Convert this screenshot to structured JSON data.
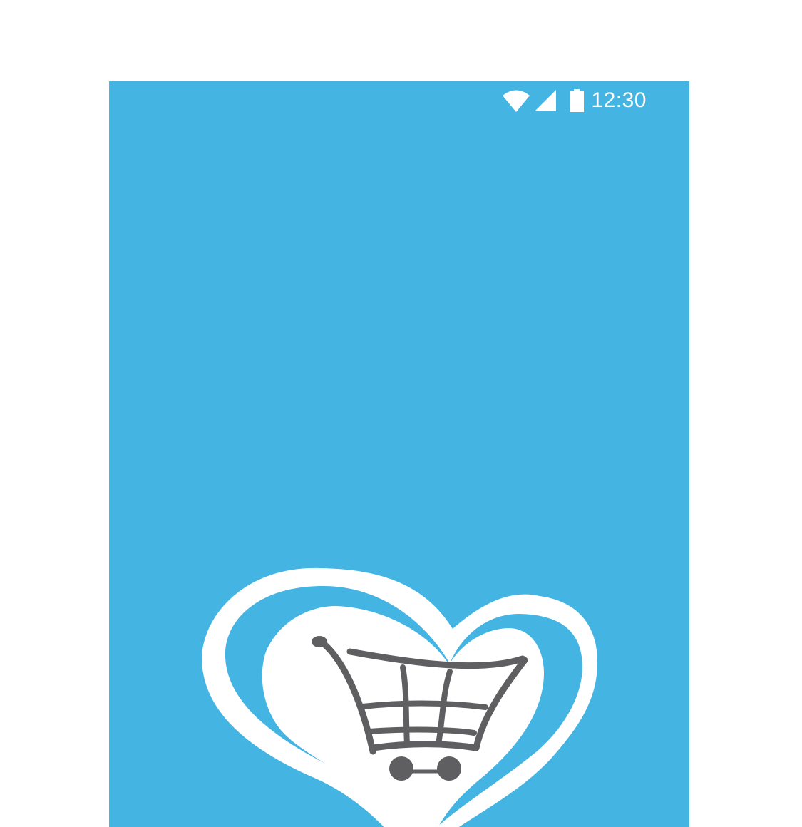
{
  "colors": {
    "background": "#44b4e3",
    "status_bar_foreground": "#ffffff",
    "logo_outline": "#ffffff",
    "cart": "#5f5e60"
  },
  "status_bar": {
    "time": "12:30",
    "icons": [
      "wifi-icon",
      "signal-icon",
      "battery-icon"
    ]
  },
  "splash": {
    "logo": "heart-cart-logo"
  }
}
